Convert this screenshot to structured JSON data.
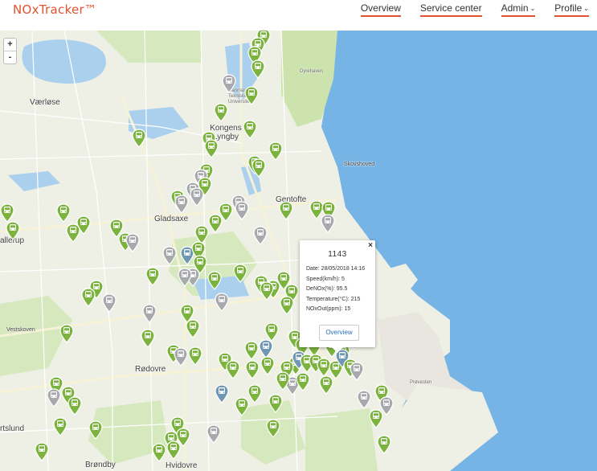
{
  "header": {
    "brand": "NOxTracker™",
    "nav": [
      {
        "label": "Overview"
      },
      {
        "label": "Service center"
      },
      {
        "label": "Admin"
      },
      {
        "label": "Profile"
      }
    ]
  },
  "map": {
    "zoom_in": "+",
    "zoom_out": "-",
    "labels": {
      "vaerloese": "Værløse",
      "gladsaxe": "Gladsaxe",
      "lyngby": "Kongens Lyngby",
      "gentofte": "Gentofte",
      "rodovre": "Rødovre",
      "brondby": "Brøndby",
      "hvidovre": "Hvidovre",
      "skovshoved": "Skovshoved",
      "vestskoven": "Vestskoven",
      "dyrehaven": "Dyrehaven",
      "provesten": "Prøvesten",
      "albertslund": "rtslund",
      "ballerup": "allerup",
      "dtu": "Danmarks Tekniske Universitet"
    },
    "colors": {
      "green": "#7bb33e",
      "gray": "#a7a9ac",
      "blue": "#6f96b3",
      "sea": "#75b4e5",
      "land": "#eef0e6",
      "park": "#cde3ad",
      "lake": "#abd0ee"
    }
  },
  "popup": {
    "title": "1143",
    "close": "×",
    "rows": [
      "Date: 28/05/2018 14:16",
      "Speed(km/h): 5",
      "DeNOx(%): 95.5",
      "Temperature(°C): 215",
      "NOxOut(ppm): 15"
    ],
    "button": "Overview"
  }
}
